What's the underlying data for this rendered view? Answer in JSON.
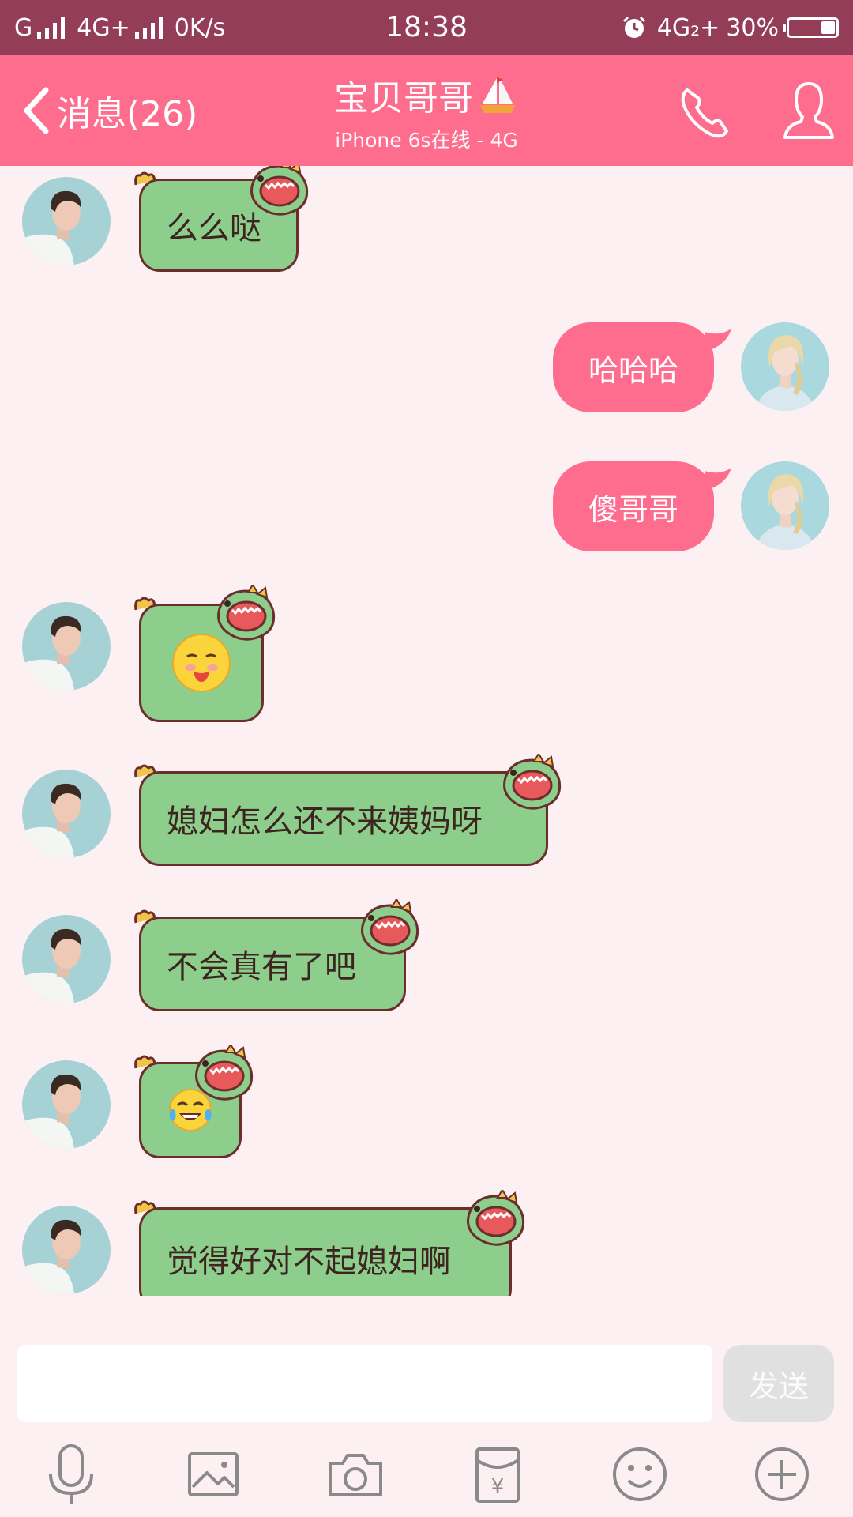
{
  "status_bar": {
    "carrier1": "G",
    "carrier2": "4G+",
    "speed": "0K/s",
    "time": "18:38",
    "network": "4G₂+",
    "battery": "30%",
    "battery_level": 0.3
  },
  "header": {
    "back_label": "消息(26)",
    "contact_name": "宝贝哥哥",
    "contact_status": "iPhone 6s在线 - 4G"
  },
  "messages": [
    {
      "side": "left",
      "text": "么么哒"
    },
    {
      "side": "right",
      "text": "哈哈哈"
    },
    {
      "side": "right",
      "text": "傻哥哥"
    },
    {
      "side": "left",
      "emoji": "tongue-out-emoji"
    },
    {
      "side": "left",
      "text": "媳妇怎么还不来姨妈呀"
    },
    {
      "side": "left",
      "text": "不会真有了吧"
    },
    {
      "side": "left",
      "emoji": "tears-of-joy-emoji"
    },
    {
      "side": "left",
      "text": "觉得好对不起媳妇啊"
    }
  ],
  "composer": {
    "input_value": "",
    "send_label": "发送"
  },
  "toolbar_icons": [
    "microphone-icon",
    "image-icon",
    "camera-icon",
    "red-packet-icon",
    "emoji-icon",
    "plus-icon"
  ],
  "colors": {
    "status_bar": "#933d58",
    "header": "#fe6c8e",
    "background": "#fcf0f3",
    "left_bubble": "#8ece8c",
    "right_bubble": "#fe6c8e"
  }
}
